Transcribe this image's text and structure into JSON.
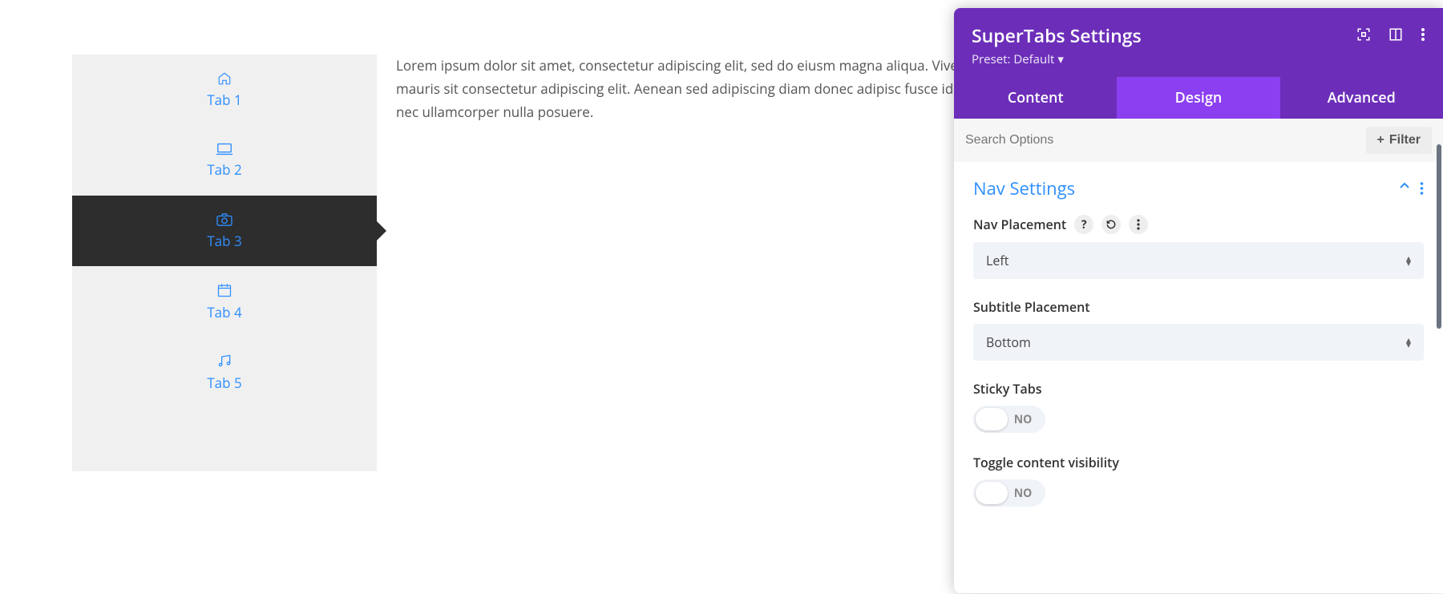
{
  "preview": {
    "tabs": [
      {
        "label": "Tab 1",
        "icon": "home"
      },
      {
        "label": "Tab 2",
        "icon": "laptop"
      },
      {
        "label": "Tab 3",
        "icon": "camera",
        "active": true
      },
      {
        "label": "Tab 4",
        "icon": "calendar"
      },
      {
        "label": "Tab 5",
        "icon": "music"
      }
    ],
    "content": "Lorem ipsum dolor sit amet, consectetur adipiscing elit, sed do eiusm magna aliqua. Viverra orci sagittis eu volutpat odio facilisis mauris sit consectetur adipiscing elit. Aenean sed adipiscing diam donec adipisc fusce id velit ut tortor pretium. Faucibus vitae aliquet nec ullamcorper nulla posuere."
  },
  "panel": {
    "title": "SuperTabs Settings",
    "preset_label": "Preset: Default",
    "tabs": [
      {
        "label": "Content"
      },
      {
        "label": "Design",
        "active": true
      },
      {
        "label": "Advanced"
      }
    ],
    "search_placeholder": "Search Options",
    "filter_label": "Filter",
    "section": {
      "title": "Nav Settings",
      "fields": {
        "nav_placement": {
          "label": "Nav Placement",
          "value": "Left"
        },
        "subtitle_placement": {
          "label": "Subtitle Placement",
          "value": "Bottom"
        },
        "sticky_tabs": {
          "label": "Sticky Tabs",
          "value": "NO"
        },
        "toggle_visibility": {
          "label": "Toggle content visibility",
          "value": "NO"
        }
      }
    }
  }
}
